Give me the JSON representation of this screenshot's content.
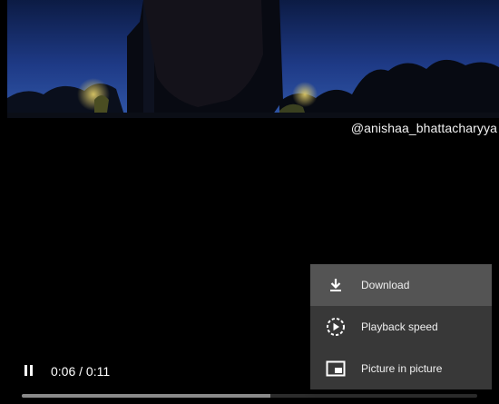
{
  "video": {
    "watermark": "@anishaa_bhattacharyya"
  },
  "controls": {
    "play_state": "playing",
    "toggle_icon": "pause-icon",
    "current_time": "0:06",
    "duration": "0:11",
    "time_display": "0:06 / 0:11",
    "progress_fraction": 0.545
  },
  "menu": {
    "items": [
      {
        "label": "Download",
        "icon": "download-icon",
        "active": true
      },
      {
        "label": "Playback speed",
        "icon": "playback-speed-icon",
        "active": false
      },
      {
        "label": "Picture in picture",
        "icon": "picture-in-picture-icon",
        "active": false
      }
    ]
  },
  "colors": {
    "background": "#000000",
    "menu_bg": "#383838",
    "menu_active_bg": "#545454",
    "text": "#ffffff"
  }
}
